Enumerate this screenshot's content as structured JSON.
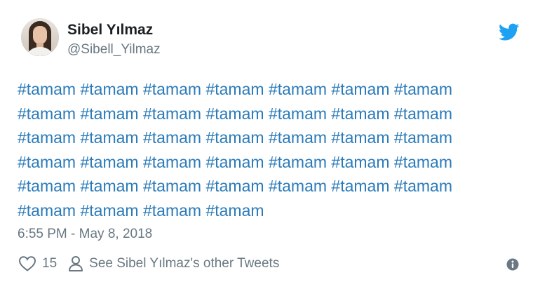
{
  "user": {
    "display_name": "Sibel Yılmaz",
    "handle": "@Sibell_Yilmaz"
  },
  "tweet": {
    "hashtags": [
      "#tamam",
      "#tamam",
      "#tamam",
      "#tamam",
      "#tamam",
      "#tamam",
      "#tamam",
      "#tamam",
      "#tamam",
      "#tamam",
      "#tamam",
      "#tamam",
      "#tamam",
      "#tamam",
      "#tamam",
      "#tamam",
      "#tamam",
      "#tamam",
      "#tamam",
      "#tamam",
      "#tamam",
      "#tamam",
      "#tamam",
      "#tamam",
      "#tamam",
      "#tamam",
      "#tamam",
      "#tamam",
      "#tamam",
      "#tamam",
      "#tamam",
      "#tamam",
      "#tamam",
      "#tamam",
      "#tamam",
      "#tamam",
      "#tamam",
      "#tamam",
      "#tamam"
    ],
    "timestamp": "6:55 PM - May 8, 2018"
  },
  "actions": {
    "like_count": "15",
    "other_tweets_label": "See Sibel Yılmaz's other Tweets"
  },
  "icons": {
    "brand": "twitter-bird-icon",
    "like": "heart-icon",
    "profile": "person-icon",
    "info": "info-icon"
  },
  "colors": {
    "link": "#2b7bb9",
    "twitter_blue": "#1da1f2",
    "muted": "#697882",
    "name": "#1c2022"
  }
}
